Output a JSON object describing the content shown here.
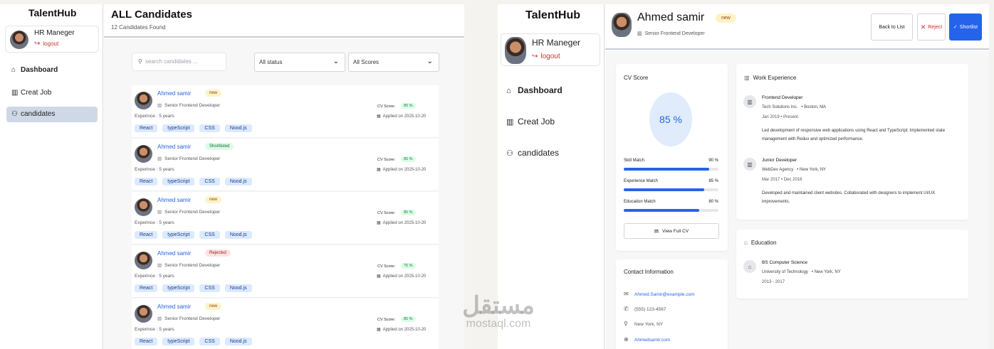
{
  "left": {
    "brand": "TalentHub",
    "user": {
      "name": "HR Maneger",
      "logout": "logout"
    },
    "nav": [
      {
        "label": "Dashboard",
        "icon": "home-icon"
      },
      {
        "label": "Creat Job",
        "icon": "building-icon"
      },
      {
        "label": "candidates",
        "icon": "users-icon"
      }
    ],
    "header": {
      "title": "ALL Candidates",
      "subtitle": "12 Candidates Found"
    },
    "search": {
      "placeholder": "search candidates ..."
    },
    "filters": {
      "status": "All status",
      "scores": "All Scores"
    },
    "candidates": [
      {
        "name": "Ahmed samir",
        "status": "new",
        "role": "Senior Frontend Developer",
        "experience": "Experince : 5 years",
        "cv_label": "CV Score:",
        "cv_score": "85 %",
        "applied": "Applied on  2025-10-20",
        "tags": [
          "React",
          "typeScript",
          "CSS",
          "Nood.js"
        ]
      },
      {
        "name": "Ahmed samir",
        "status": "Shortlisted",
        "role": "Senior Frontend Developer",
        "experience": "Experince : 5 years",
        "cv_label": "CV Score:",
        "cv_score": "85 %",
        "applied": "Applied on  2025-10-20",
        "tags": [
          "React",
          "typeScript",
          "CSS",
          "Nood.js"
        ]
      },
      {
        "name": "Ahmed samir",
        "status": "new",
        "role": "Senior Frontend Developer",
        "experience": "Experince : 5 years",
        "cv_label": "CV Score:",
        "cv_score": "85 %",
        "applied": "Applied on  2025-10-20",
        "tags": [
          "React",
          "typeScript",
          "CSS",
          "Nood.js"
        ]
      },
      {
        "name": "Ahmed samir",
        "status": "Rejected",
        "role": "Senior Frontend Developer",
        "experience": "Experince : 5 years",
        "cv_label": "CV Score:",
        "cv_score": "75 %",
        "applied": "Applied on  2025-10-20",
        "tags": [
          "React",
          "typeScript",
          "CSS",
          "Nood.js"
        ]
      },
      {
        "name": "Ahmed samir",
        "status": "new",
        "role": "Senior Frontend Developer",
        "experience": "Experince : 5 years",
        "cv_label": "CV Score:",
        "cv_score": "85 %",
        "applied": "Applied on  2025-10-20",
        "tags": [
          "React",
          "typeScript",
          "CSS",
          "Nood.js"
        ]
      }
    ]
  },
  "right": {
    "brand": "TalentHub",
    "user": {
      "name": "HR Maneger",
      "logout": "logout"
    },
    "nav": [
      {
        "label": "Dashboard"
      },
      {
        "label": "Creat Job"
      },
      {
        "label": "candidates"
      }
    ],
    "profile": {
      "name": "Ahmed samir",
      "status": "new",
      "role": "Senior Frontend Developer"
    },
    "buttons": {
      "back": "Back to List",
      "reject": "Reject",
      "shortlist": "Shortlist"
    },
    "cv": {
      "title": "CV Score",
      "score": "85 %",
      "metrics": [
        {
          "label": "Skill Match",
          "value": "90 %",
          "fraction": 0.9
        },
        {
          "label": "Experience Match",
          "value": "85 %",
          "fraction": 0.85
        },
        {
          "label": "Education Match",
          "value": "80 %",
          "fraction": 0.8
        }
      ],
      "view_button": "View Full CV"
    },
    "contact": {
      "title": "Contact Information",
      "email": "Ahmed.Samir@example.com",
      "phone": "(555) 123-4567",
      "location": "New York, NY",
      "website": "Ahmedsamir.com"
    },
    "work": {
      "title": "Work Experience",
      "jobs": [
        {
          "title": "Frontend Developer",
          "company": "Tech Solutions Inc.",
          "location": "Boston, MA",
          "dates": "Jan 2019  •  Present",
          "desc": "Led development of responsive web applications using React and TypeScript. Implemented state management with Redux and optimized performance."
        },
        {
          "title": "Junior Developer",
          "company": "WebDev Agency",
          "location": "New York, NY",
          "dates": "Mar 2017  •  Dec 2018",
          "desc": "Developed and maintained client websites. Collaborated with designers to implement UI/UX improvements."
        }
      ]
    },
    "education": {
      "title": "Education",
      "degree": "BS Computer Science",
      "school": "University of Technology",
      "location": "New York, NY",
      "years": "2013  -  2017"
    }
  },
  "watermark": {
    "arabic": "مستقل",
    "latin": "mostaql.com"
  },
  "colors": {
    "accent": "#2563eb",
    "danger": "#dc2626",
    "active_nav": "#cfd8e6"
  }
}
